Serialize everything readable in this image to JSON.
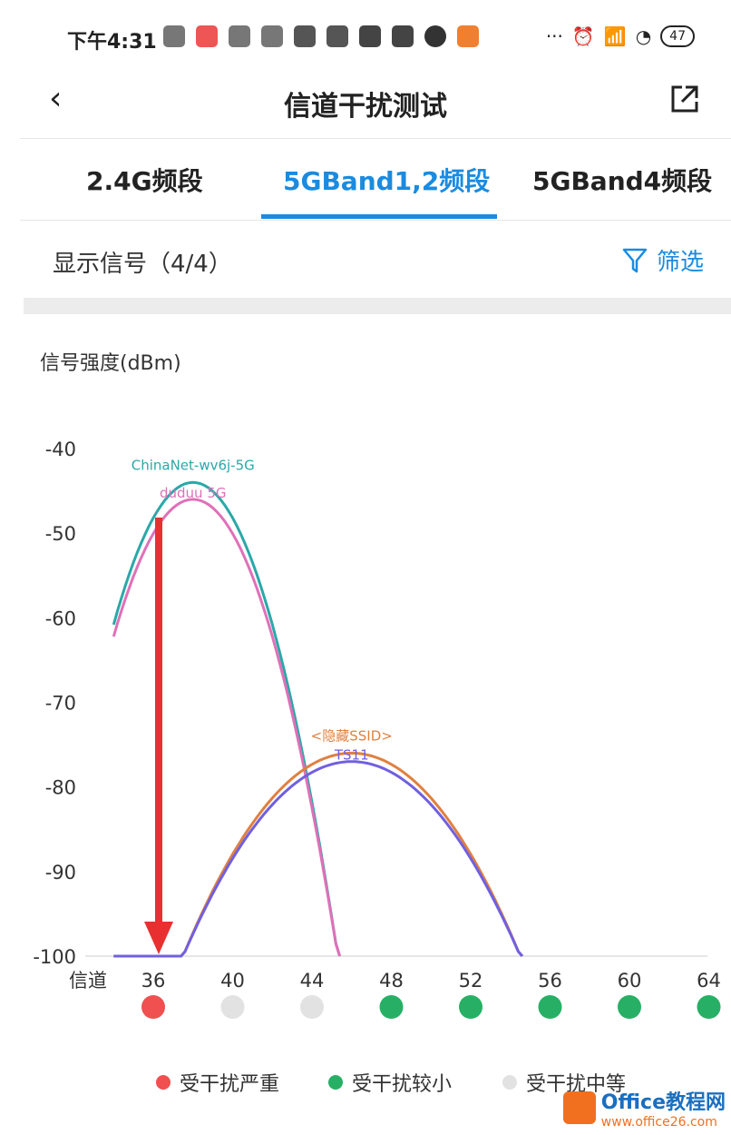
{
  "status": {
    "time": "下午4:31",
    "battery": "47"
  },
  "appbar": {
    "title": "信道干扰测试"
  },
  "tabs": [
    {
      "label": "2.4G频段",
      "active": false
    },
    {
      "label": "5GBand1,2频段",
      "active": true
    },
    {
      "label": "5GBand4频段",
      "active": false
    }
  ],
  "toolbar": {
    "show_signal": "显示信号（4/4）",
    "filter_label": "筛选"
  },
  "chart_data": {
    "type": "line",
    "ylabel": "信号强度(dBm)",
    "xlabel": "信道",
    "ylim": [
      -100,
      -40
    ],
    "yticks": [
      -40,
      -50,
      -60,
      -70,
      -80,
      -90,
      -100
    ],
    "x_categories": [
      36,
      40,
      44,
      48,
      52,
      56,
      60,
      64
    ],
    "series": [
      {
        "name": "ChinaNet-wv6j-5G",
        "peak_channel": 38,
        "peak_dbm": -44,
        "color": "#2aa8a8"
      },
      {
        "name": "duduu 5G",
        "peak_channel": 38,
        "peak_dbm": -46,
        "color": "#e070b8"
      },
      {
        "name": "<隐藏SSID>",
        "peak_channel": 46,
        "peak_dbm": -76,
        "color": "#e08040"
      },
      {
        "name": "TS11",
        "peak_channel": 46,
        "peak_dbm": -77,
        "color": "#7060e0"
      }
    ],
    "channel_status": [
      {
        "channel": 36,
        "status": "严重",
        "color": "#f05050"
      },
      {
        "channel": 40,
        "status": "中等",
        "color": "#e2e2e2"
      },
      {
        "channel": 44,
        "status": "中等",
        "color": "#e2e2e2"
      },
      {
        "channel": 48,
        "status": "较小",
        "color": "#27b065"
      },
      {
        "channel": 52,
        "status": "较小",
        "color": "#27b065"
      },
      {
        "channel": 56,
        "status": "较小",
        "color": "#27b065"
      },
      {
        "channel": 60,
        "status": "较小",
        "color": "#27b065"
      },
      {
        "channel": 64,
        "status": "较小",
        "color": "#27b065"
      }
    ]
  },
  "legend": [
    {
      "label": "受干扰严重",
      "color": "#f05050"
    },
    {
      "label": "受干扰较小",
      "color": "#27b065"
    },
    {
      "label": "受干扰中等",
      "color": "#e2e2e2"
    }
  ],
  "watermark": {
    "text": "Office教程网",
    "sub": "www.office26.com"
  }
}
